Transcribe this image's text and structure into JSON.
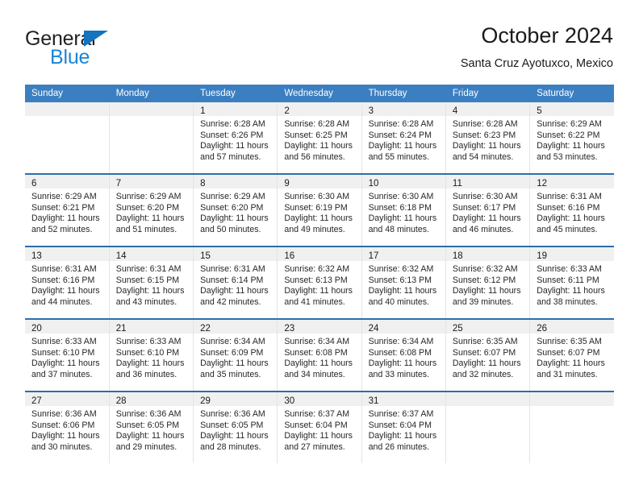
{
  "brand": {
    "name_top": "General",
    "name_bottom": "Blue",
    "triangle_color": "#1474bd",
    "blue_color": "#1a85d6"
  },
  "header": {
    "title": "October 2024",
    "subtitle": "Santa Cruz Ayotuxco, Mexico"
  },
  "theme": {
    "header_blue": "#3c7fc1",
    "row_separator_blue": "#2e6da8",
    "daynum_band": "#f0f0f0",
    "column_divider": "#e4e4e4"
  },
  "weekday_headers": [
    "Sunday",
    "Monday",
    "Tuesday",
    "Wednesday",
    "Thursday",
    "Friday",
    "Saturday"
  ],
  "weeks": [
    [
      {
        "day": "",
        "sunrise": "",
        "sunset": "",
        "daylight_l1": "",
        "daylight_l2": ""
      },
      {
        "day": "",
        "sunrise": "",
        "sunset": "",
        "daylight_l1": "",
        "daylight_l2": ""
      },
      {
        "day": "1",
        "sunrise": "Sunrise: 6:28 AM",
        "sunset": "Sunset: 6:26 PM",
        "daylight_l1": "Daylight: 11 hours",
        "daylight_l2": "and 57 minutes."
      },
      {
        "day": "2",
        "sunrise": "Sunrise: 6:28 AM",
        "sunset": "Sunset: 6:25 PM",
        "daylight_l1": "Daylight: 11 hours",
        "daylight_l2": "and 56 minutes."
      },
      {
        "day": "3",
        "sunrise": "Sunrise: 6:28 AM",
        "sunset": "Sunset: 6:24 PM",
        "daylight_l1": "Daylight: 11 hours",
        "daylight_l2": "and 55 minutes."
      },
      {
        "day": "4",
        "sunrise": "Sunrise: 6:28 AM",
        "sunset": "Sunset: 6:23 PM",
        "daylight_l1": "Daylight: 11 hours",
        "daylight_l2": "and 54 minutes."
      },
      {
        "day": "5",
        "sunrise": "Sunrise: 6:29 AM",
        "sunset": "Sunset: 6:22 PM",
        "daylight_l1": "Daylight: 11 hours",
        "daylight_l2": "and 53 minutes."
      }
    ],
    [
      {
        "day": "6",
        "sunrise": "Sunrise: 6:29 AM",
        "sunset": "Sunset: 6:21 PM",
        "daylight_l1": "Daylight: 11 hours",
        "daylight_l2": "and 52 minutes."
      },
      {
        "day": "7",
        "sunrise": "Sunrise: 6:29 AM",
        "sunset": "Sunset: 6:20 PM",
        "daylight_l1": "Daylight: 11 hours",
        "daylight_l2": "and 51 minutes."
      },
      {
        "day": "8",
        "sunrise": "Sunrise: 6:29 AM",
        "sunset": "Sunset: 6:20 PM",
        "daylight_l1": "Daylight: 11 hours",
        "daylight_l2": "and 50 minutes."
      },
      {
        "day": "9",
        "sunrise": "Sunrise: 6:30 AM",
        "sunset": "Sunset: 6:19 PM",
        "daylight_l1": "Daylight: 11 hours",
        "daylight_l2": "and 49 minutes."
      },
      {
        "day": "10",
        "sunrise": "Sunrise: 6:30 AM",
        "sunset": "Sunset: 6:18 PM",
        "daylight_l1": "Daylight: 11 hours",
        "daylight_l2": "and 48 minutes."
      },
      {
        "day": "11",
        "sunrise": "Sunrise: 6:30 AM",
        "sunset": "Sunset: 6:17 PM",
        "daylight_l1": "Daylight: 11 hours",
        "daylight_l2": "and 46 minutes."
      },
      {
        "day": "12",
        "sunrise": "Sunrise: 6:31 AM",
        "sunset": "Sunset: 6:16 PM",
        "daylight_l1": "Daylight: 11 hours",
        "daylight_l2": "and 45 minutes."
      }
    ],
    [
      {
        "day": "13",
        "sunrise": "Sunrise: 6:31 AM",
        "sunset": "Sunset: 6:16 PM",
        "daylight_l1": "Daylight: 11 hours",
        "daylight_l2": "and 44 minutes."
      },
      {
        "day": "14",
        "sunrise": "Sunrise: 6:31 AM",
        "sunset": "Sunset: 6:15 PM",
        "daylight_l1": "Daylight: 11 hours",
        "daylight_l2": "and 43 minutes."
      },
      {
        "day": "15",
        "sunrise": "Sunrise: 6:31 AM",
        "sunset": "Sunset: 6:14 PM",
        "daylight_l1": "Daylight: 11 hours",
        "daylight_l2": "and 42 minutes."
      },
      {
        "day": "16",
        "sunrise": "Sunrise: 6:32 AM",
        "sunset": "Sunset: 6:13 PM",
        "daylight_l1": "Daylight: 11 hours",
        "daylight_l2": "and 41 minutes."
      },
      {
        "day": "17",
        "sunrise": "Sunrise: 6:32 AM",
        "sunset": "Sunset: 6:13 PM",
        "daylight_l1": "Daylight: 11 hours",
        "daylight_l2": "and 40 minutes."
      },
      {
        "day": "18",
        "sunrise": "Sunrise: 6:32 AM",
        "sunset": "Sunset: 6:12 PM",
        "daylight_l1": "Daylight: 11 hours",
        "daylight_l2": "and 39 minutes."
      },
      {
        "day": "19",
        "sunrise": "Sunrise: 6:33 AM",
        "sunset": "Sunset: 6:11 PM",
        "daylight_l1": "Daylight: 11 hours",
        "daylight_l2": "and 38 minutes."
      }
    ],
    [
      {
        "day": "20",
        "sunrise": "Sunrise: 6:33 AM",
        "sunset": "Sunset: 6:10 PM",
        "daylight_l1": "Daylight: 11 hours",
        "daylight_l2": "and 37 minutes."
      },
      {
        "day": "21",
        "sunrise": "Sunrise: 6:33 AM",
        "sunset": "Sunset: 6:10 PM",
        "daylight_l1": "Daylight: 11 hours",
        "daylight_l2": "and 36 minutes."
      },
      {
        "day": "22",
        "sunrise": "Sunrise: 6:34 AM",
        "sunset": "Sunset: 6:09 PM",
        "daylight_l1": "Daylight: 11 hours",
        "daylight_l2": "and 35 minutes."
      },
      {
        "day": "23",
        "sunrise": "Sunrise: 6:34 AM",
        "sunset": "Sunset: 6:08 PM",
        "daylight_l1": "Daylight: 11 hours",
        "daylight_l2": "and 34 minutes."
      },
      {
        "day": "24",
        "sunrise": "Sunrise: 6:34 AM",
        "sunset": "Sunset: 6:08 PM",
        "daylight_l1": "Daylight: 11 hours",
        "daylight_l2": "and 33 minutes."
      },
      {
        "day": "25",
        "sunrise": "Sunrise: 6:35 AM",
        "sunset": "Sunset: 6:07 PM",
        "daylight_l1": "Daylight: 11 hours",
        "daylight_l2": "and 32 minutes."
      },
      {
        "day": "26",
        "sunrise": "Sunrise: 6:35 AM",
        "sunset": "Sunset: 6:07 PM",
        "daylight_l1": "Daylight: 11 hours",
        "daylight_l2": "and 31 minutes."
      }
    ],
    [
      {
        "day": "27",
        "sunrise": "Sunrise: 6:36 AM",
        "sunset": "Sunset: 6:06 PM",
        "daylight_l1": "Daylight: 11 hours",
        "daylight_l2": "and 30 minutes."
      },
      {
        "day": "28",
        "sunrise": "Sunrise: 6:36 AM",
        "sunset": "Sunset: 6:05 PM",
        "daylight_l1": "Daylight: 11 hours",
        "daylight_l2": "and 29 minutes."
      },
      {
        "day": "29",
        "sunrise": "Sunrise: 6:36 AM",
        "sunset": "Sunset: 6:05 PM",
        "daylight_l1": "Daylight: 11 hours",
        "daylight_l2": "and 28 minutes."
      },
      {
        "day": "30",
        "sunrise": "Sunrise: 6:37 AM",
        "sunset": "Sunset: 6:04 PM",
        "daylight_l1": "Daylight: 11 hours",
        "daylight_l2": "and 27 minutes."
      },
      {
        "day": "31",
        "sunrise": "Sunrise: 6:37 AM",
        "sunset": "Sunset: 6:04 PM",
        "daylight_l1": "Daylight: 11 hours",
        "daylight_l2": "and 26 minutes."
      },
      {
        "day": "",
        "sunrise": "",
        "sunset": "",
        "daylight_l1": "",
        "daylight_l2": ""
      },
      {
        "day": "",
        "sunrise": "",
        "sunset": "",
        "daylight_l1": "",
        "daylight_l2": ""
      }
    ]
  ]
}
